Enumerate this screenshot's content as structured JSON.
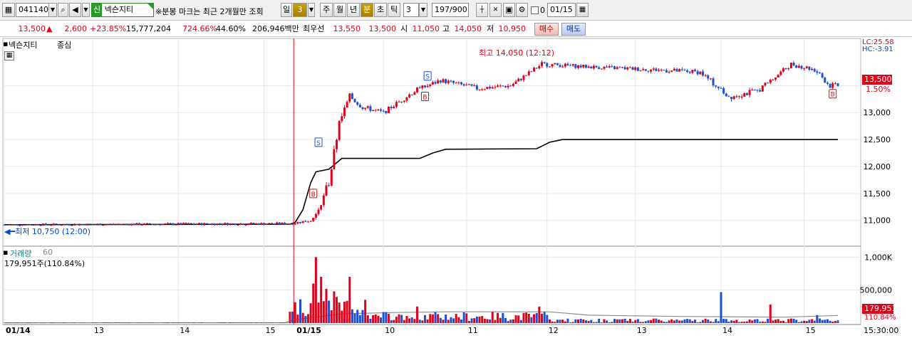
{
  "toolbar": {
    "stock_code": "041140",
    "search_icon": "search-icon",
    "speaker_icon": "speaker-icon",
    "credit_badge": "신",
    "stock_name": "넥슨지티",
    "notice": "※분봉 마크는 최근 2개월만 조회",
    "periods": [
      "일",
      "주",
      "월",
      "년",
      "분",
      "초",
      "틱"
    ],
    "active_period": "분",
    "day_count": "3",
    "interval": "3",
    "page_count": "197/900",
    "date_checkbox_label": "0",
    "date": "01/15"
  },
  "quote": {
    "price": "13,500",
    "direction_symbol": "▲",
    "change": "2,600",
    "change_pct": "+23.85%",
    "volume": "15,777,204",
    "volume_ratio": "724.66%",
    "turnover": "44.60%",
    "amount": "206,946백만",
    "ask_label": "최우선",
    "ask": "13,550",
    "bid": "13,500",
    "open_label": "시",
    "open": "11,050",
    "high_label": "고",
    "high": "14,050",
    "low_label": "저",
    "low": "10,950",
    "buy_button": "매수",
    "sell_button": "매도"
  },
  "price_panel": {
    "legend_name": "넥슨지티",
    "legend_type": "종심",
    "lc_label": "LC:25.58",
    "hc_label": "HC:-3.91",
    "high_annotation": "최고 14,050 (12:12)",
    "low_annotation": "최저 10,750 (12:00)",
    "current_price_tag": "13,500",
    "current_pct_tag": "1.50%",
    "y_ticks": [
      "13,000",
      "12,500",
      "12,000",
      "11,500",
      "11,000"
    ]
  },
  "volume_panel": {
    "title": "거래량",
    "period": "60",
    "current_volume": "179,951주(110.84%)",
    "y_ticks": [
      "1,000K",
      "500,000"
    ],
    "current_tag": "179,951",
    "current_pct_tag": "110.84%"
  },
  "x_axis": {
    "labels": [
      "01/14",
      "13",
      "14",
      "15",
      "01/15",
      "10",
      "11",
      "12",
      "13",
      "14",
      "15"
    ],
    "time_label": "15:30:00"
  },
  "colors": {
    "up": "#e0001a",
    "down": "#1d4fd6",
    "grid": "#e6e6e6",
    "line": "#000000"
  },
  "chart_data": {
    "type": "candlestick",
    "unit": "KRW",
    "price_axis": {
      "ylim": [
        10600,
        14350
      ],
      "ticks": [
        11000,
        11500,
        12000,
        12500,
        13000,
        13500
      ]
    },
    "volume_axis": {
      "ylim": [
        0,
        1100000
      ],
      "ticks": [
        500000,
        1000000
      ]
    },
    "day_break_label": "01/15",
    "price_segments": [
      {
        "t": 0,
        "p": 10920,
        "noise": 25
      },
      {
        "t": 110,
        "p": 10940,
        "noise": 35
      },
      {
        "t": 118,
        "p": 11000,
        "noise": 40
      },
      {
        "t": 120,
        "p": 11100,
        "noise": 60
      },
      {
        "t": 125,
        "p": 11700,
        "noise": 120
      },
      {
        "t": 129,
        "p": 12800,
        "noise": 120
      },
      {
        "t": 133,
        "p": 13300,
        "noise": 80
      },
      {
        "t": 138,
        "p": 13100,
        "noise": 70
      },
      {
        "t": 146,
        "p": 13000,
        "noise": 60
      },
      {
        "t": 158,
        "p": 13400,
        "noise": 70
      },
      {
        "t": 168,
        "p": 13600,
        "noise": 60
      },
      {
        "t": 182,
        "p": 13450,
        "noise": 70
      },
      {
        "t": 195,
        "p": 13500,
        "noise": 60
      },
      {
        "t": 207,
        "p": 13900,
        "noise": 60
      },
      {
        "t": 225,
        "p": 13850,
        "noise": 50
      },
      {
        "t": 248,
        "p": 13800,
        "noise": 60
      },
      {
        "t": 268,
        "p": 13750,
        "noise": 60
      },
      {
        "t": 279,
        "p": 13300,
        "noise": 90
      },
      {
        "t": 290,
        "p": 13400,
        "noise": 70
      },
      {
        "t": 303,
        "p": 13900,
        "noise": 60
      },
      {
        "t": 312,
        "p": 13800,
        "noise": 70
      },
      {
        "t": 318,
        "p": 13500,
        "noise": 80
      },
      {
        "t": 321,
        "p": 13500,
        "noise": 60
      }
    ],
    "avg_line": [
      [
        0,
        10920
      ],
      [
        110,
        10930
      ],
      [
        112,
        10960
      ],
      [
        115,
        11200
      ],
      [
        118,
        11700
      ],
      [
        120,
        11900
      ],
      [
        125,
        11950
      ],
      [
        130,
        12150
      ],
      [
        160,
        12150
      ],
      [
        165,
        12250
      ],
      [
        170,
        12320
      ],
      [
        205,
        12330
      ],
      [
        210,
        12450
      ],
      [
        215,
        12500
      ],
      [
        321,
        12500
      ]
    ],
    "volume_avg_line": [
      [
        0,
        4000
      ],
      [
        108,
        5000
      ],
      [
        112,
        50000
      ],
      [
        130,
        140000
      ],
      [
        150,
        160000
      ],
      [
        170,
        170000
      ],
      [
        210,
        170000
      ],
      [
        225,
        120000
      ],
      [
        260,
        100000
      ],
      [
        300,
        90000
      ],
      [
        321,
        115000
      ]
    ],
    "volume_spikes": [
      [
        118,
        300000
      ],
      [
        119,
        600000
      ],
      [
        120,
        1000000
      ],
      [
        122,
        700000
      ],
      [
        124,
        520000
      ],
      [
        127,
        480000
      ],
      [
        133,
        700000
      ],
      [
        159,
        250000
      ],
      [
        206,
        250000
      ],
      [
        276,
        470000
      ],
      [
        295,
        280000
      ],
      [
        313,
        120000
      ]
    ],
    "markers": [
      {
        "t": 119,
        "p": 11500,
        "type": "B"
      },
      {
        "t": 121,
        "p": 12450,
        "type": "S"
      },
      {
        "t": 162,
        "p": 13300,
        "type": "B"
      },
      {
        "t": 163,
        "p": 13680,
        "type": "S"
      },
      {
        "t": 319,
        "p": 13350,
        "type": "B"
      }
    ],
    "x_tick_positions": [
      0,
      34,
      67,
      100,
      112,
      146,
      178,
      209,
      243,
      276,
      308
    ],
    "n_bars": 322
  }
}
